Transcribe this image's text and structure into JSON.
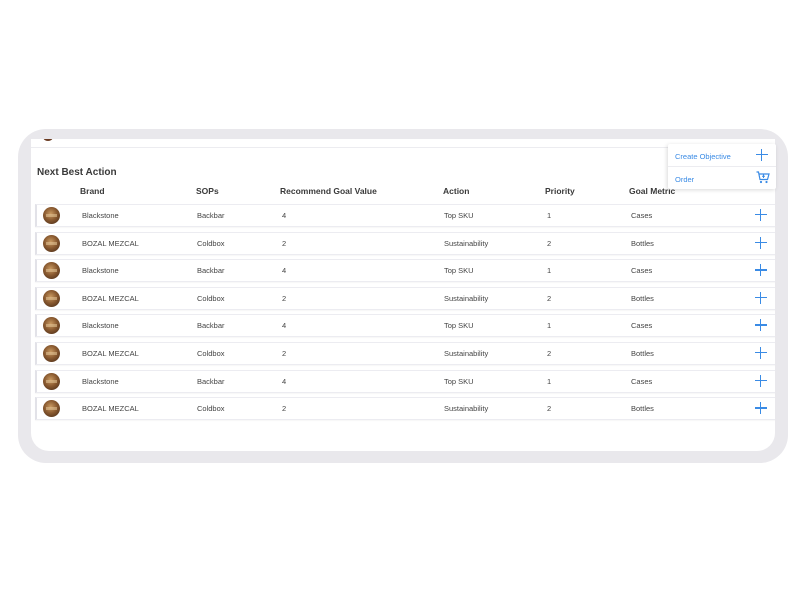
{
  "panel": {
    "title": "Next Best Action"
  },
  "table": {
    "headers": [
      "Brand",
      "SOPs",
      "Recommend Goal Value",
      "Action",
      "Priority",
      "Goal Metric"
    ],
    "rows": [
      {
        "brand": "Blackstone",
        "sop": "Backbar",
        "goal": "4",
        "action": "Top SKU",
        "priority": "1",
        "metric": "Cases"
      },
      {
        "brand": "BOZAL MEZCAL",
        "sop": "Coldbox",
        "goal": "2",
        "action": "Sustainability",
        "priority": "2",
        "metric": "Bottles"
      },
      {
        "brand": "Blackstone",
        "sop": "Backbar",
        "goal": "4",
        "action": "Top SKU",
        "priority": "1",
        "metric": "Cases"
      },
      {
        "brand": "BOZAL MEZCAL",
        "sop": "Coldbox",
        "goal": "2",
        "action": "Sustainability",
        "priority": "2",
        "metric": "Bottles"
      },
      {
        "brand": "Blackstone",
        "sop": "Backbar",
        "goal": "4",
        "action": "Top SKU",
        "priority": "1",
        "metric": "Cases"
      },
      {
        "brand": "BOZAL MEZCAL",
        "sop": "Coldbox",
        "goal": "2",
        "action": "Sustainability",
        "priority": "2",
        "metric": "Bottles"
      },
      {
        "brand": "Blackstone",
        "sop": "Backbar",
        "goal": "4",
        "action": "Top SKU",
        "priority": "1",
        "metric": "Cases"
      },
      {
        "brand": "BOZAL MEZCAL",
        "sop": "Coldbox",
        "goal": "2",
        "action": "Sustainability",
        "priority": "2",
        "metric": "Bottles"
      }
    ]
  },
  "menu": {
    "create_objective": "Create Objective",
    "order": "Order"
  },
  "colors": {
    "accent": "#3a8be5",
    "frame": "#e9e8ec"
  },
  "icons": {
    "add": "plus-icon",
    "order": "cart-icon",
    "brand": "bottle-thumbnail"
  }
}
